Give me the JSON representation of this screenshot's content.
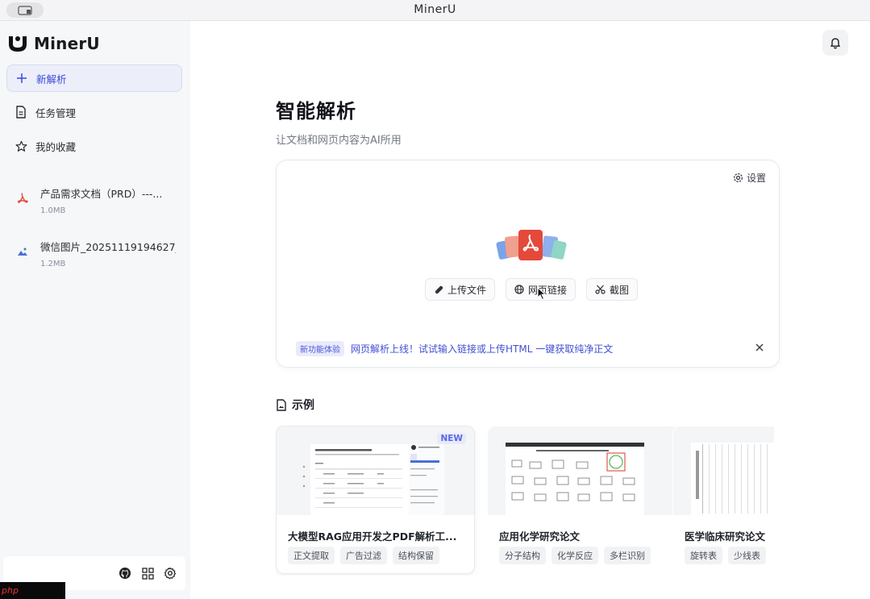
{
  "window": {
    "title": "MinerU"
  },
  "sidebar": {
    "brand": "MinerU",
    "nav": [
      {
        "label": "新解析",
        "icon": "plus-icon",
        "active": true
      },
      {
        "label": "任务管理",
        "icon": "document-icon",
        "active": false
      },
      {
        "label": "我的收藏",
        "icon": "star-icon",
        "active": false
      }
    ],
    "files": [
      {
        "name": "产品需求文档（PRD）---...",
        "size": "1.0MB",
        "icon": "pdf-icon"
      },
      {
        "name": "微信图片_20251119194627_...",
        "size": "1.2MB",
        "icon": "image-icon"
      }
    ],
    "footer_icons": [
      "github-icon",
      "grid-icon",
      "settings-gear-icon"
    ]
  },
  "main": {
    "heading": "智能解析",
    "subheading": "让文档和网页内容为AI所用",
    "upload": {
      "settings_label": "设置",
      "buttons": [
        {
          "label": "上传文件",
          "icon": "paperclip-icon"
        },
        {
          "label": "网页链接",
          "icon": "globe-icon"
        },
        {
          "label": "截图",
          "icon": "scissors-icon"
        }
      ],
      "notice_badge": "新功能体验",
      "notice_text": "网页解析上线！试试输入链接或上传HTML 一键获取纯净正文"
    },
    "examples_title": "示例",
    "examples": [
      {
        "title": "大模型RAG应用开发之PDF解析工...",
        "badge": "NEW",
        "tags": [
          "正文提取",
          "广告过滤",
          "结构保留"
        ]
      },
      {
        "title": "应用化学研究论文",
        "badge": "",
        "tags": [
          "分子结构",
          "化学反应",
          "多栏识别"
        ]
      },
      {
        "title": "医学临床研究论文",
        "badge": "",
        "tags": [
          "旋转表",
          "少线表"
        ]
      }
    ]
  },
  "watermark": "php",
  "colors": {
    "accent": "#3a49d8",
    "sidebar_bg": "#f6f7f9",
    "pdf_red": "#e5493a"
  }
}
